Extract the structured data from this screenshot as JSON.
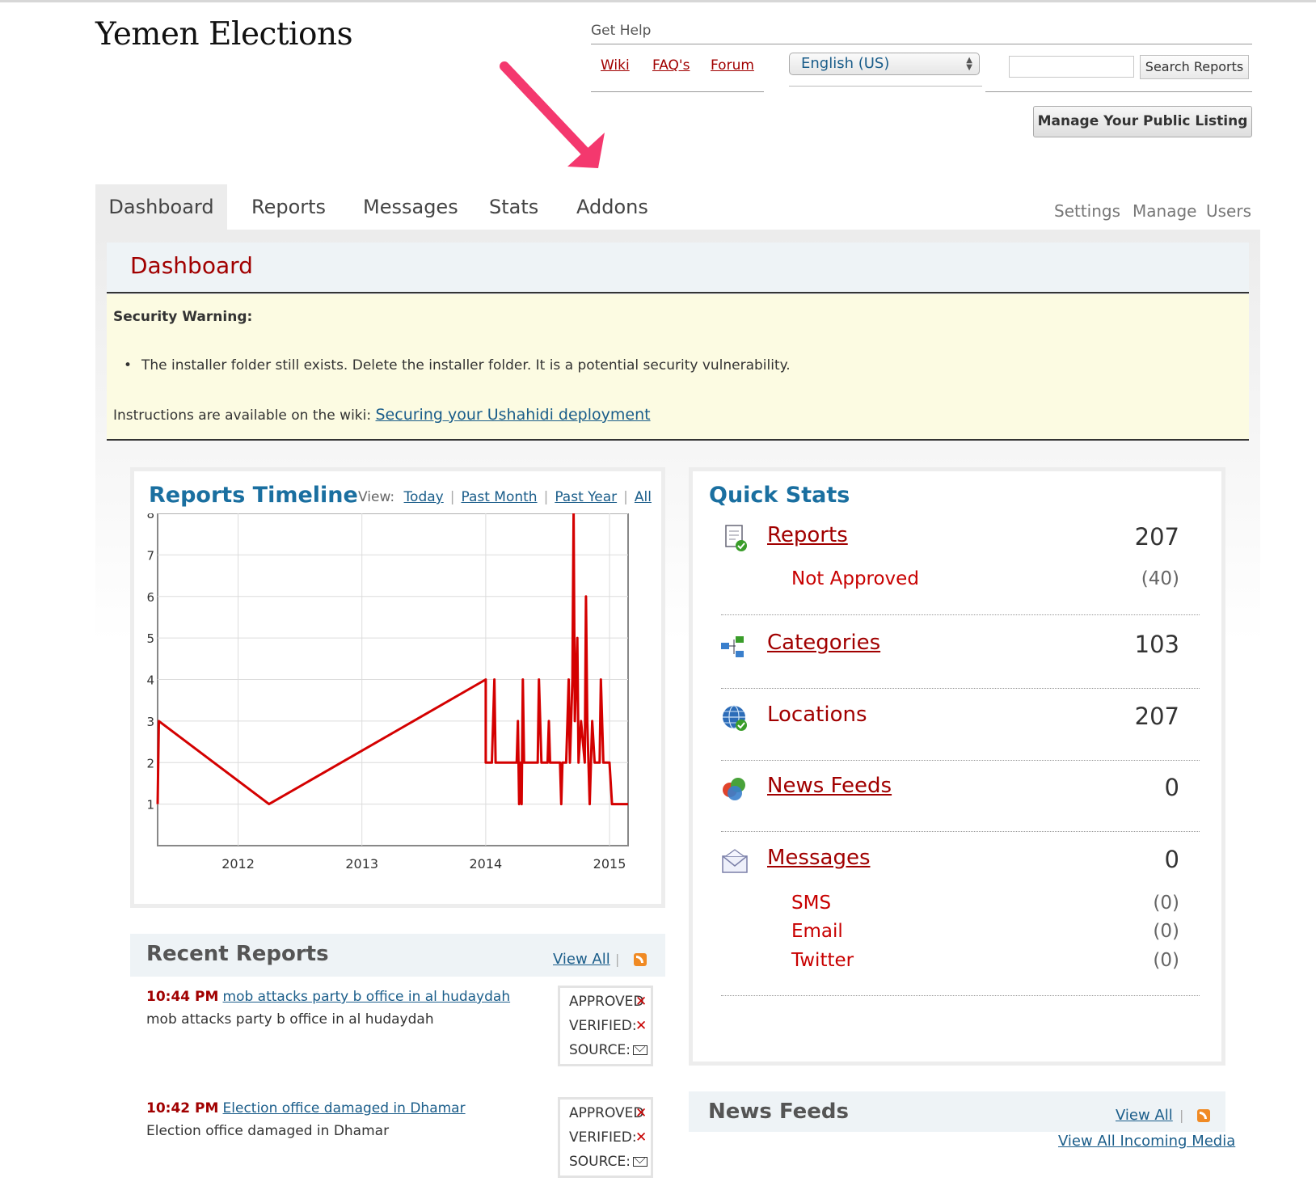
{
  "site": {
    "title": "Yemen Elections"
  },
  "help": {
    "label": "Get Help",
    "links": [
      "Wiki",
      "FAQ's",
      "Forum"
    ]
  },
  "language": {
    "selected": "English (US)"
  },
  "search": {
    "placeholder": "",
    "button": "Search Reports"
  },
  "manage_listing": "Manage Your Public Listing",
  "nav": {
    "tabs": [
      "Dashboard",
      "Reports",
      "Messages",
      "Stats",
      "Addons"
    ],
    "active": "Dashboard",
    "sub": [
      "Settings",
      "Manage",
      "Users"
    ]
  },
  "page": {
    "title": "Dashboard"
  },
  "warning": {
    "title": "Security Warning:",
    "bullet": "The installer folder still exists. Delete the installer folder. It is a potential security vulnerability.",
    "instructions_prefix": "Instructions are available on the wiki: ",
    "instructions_link": "Securing your Ushahidi deployment"
  },
  "timeline": {
    "title": "Reports Timeline",
    "view_label": "View:",
    "view_options": [
      "Today",
      "Past Month",
      "Past Year",
      "All"
    ]
  },
  "chart_data": {
    "type": "line",
    "title": "",
    "xlabel": "",
    "ylabel": "",
    "x_ticks": [
      "2012",
      "2013",
      "2014",
      "2015"
    ],
    "y_ticks": [
      1,
      2,
      3,
      4,
      5,
      6,
      7,
      8
    ],
    "xlim": [
      2011.35,
      2015.15
    ],
    "ylim": [
      0.0,
      8.0
    ],
    "grid": true,
    "series": [
      {
        "color": "#d40000",
        "points": [
          [
            2011.35,
            1
          ],
          [
            2011.36,
            3
          ],
          [
            2012.25,
            1
          ],
          [
            2014.0,
            4
          ],
          [
            2014.0,
            2
          ],
          [
            2014.05,
            2
          ],
          [
            2014.07,
            4
          ],
          [
            2014.08,
            2
          ],
          [
            2014.25,
            2
          ],
          [
            2014.26,
            3
          ],
          [
            2014.27,
            1
          ],
          [
            2014.28,
            2
          ],
          [
            2014.29,
            1
          ],
          [
            2014.3,
            4
          ],
          [
            2014.31,
            2
          ],
          [
            2014.42,
            2
          ],
          [
            2014.43,
            4
          ],
          [
            2014.45,
            2
          ],
          [
            2014.5,
            2
          ],
          [
            2014.51,
            3
          ],
          [
            2014.52,
            2
          ],
          [
            2014.6,
            2
          ],
          [
            2014.61,
            1
          ],
          [
            2014.62,
            2
          ],
          [
            2014.65,
            2
          ],
          [
            2014.66,
            3
          ],
          [
            2014.67,
            4
          ],
          [
            2014.68,
            2
          ],
          [
            2014.7,
            4
          ],
          [
            2014.71,
            8
          ],
          [
            2014.72,
            3
          ],
          [
            2014.74,
            5
          ],
          [
            2014.75,
            2
          ],
          [
            2014.77,
            3
          ],
          [
            2014.8,
            2
          ],
          [
            2014.81,
            6
          ],
          [
            2014.82,
            3
          ],
          [
            2014.84,
            1
          ],
          [
            2014.86,
            3
          ],
          [
            2014.88,
            2
          ],
          [
            2014.92,
            2
          ],
          [
            2014.93,
            4
          ],
          [
            2014.95,
            2
          ],
          [
            2014.98,
            2
          ],
          [
            2015.0,
            2
          ],
          [
            2015.02,
            1
          ],
          [
            2015.06,
            1
          ],
          [
            2015.15,
            1
          ]
        ]
      }
    ]
  },
  "quick_stats": {
    "title": "Quick Stats",
    "items": [
      {
        "label": "Reports",
        "value": "207",
        "sub": [
          {
            "label": "Not Approved",
            "value": "(40)"
          }
        ]
      },
      {
        "label": "Categories",
        "value": "103",
        "sub": []
      },
      {
        "label": "Locations",
        "value": "207",
        "sub": []
      },
      {
        "label": "News Feeds",
        "value": "0",
        "sub": []
      },
      {
        "label": "Messages",
        "value": "0",
        "sub": [
          {
            "label": "SMS",
            "value": "(0)"
          },
          {
            "label": "Email",
            "value": "(0)"
          },
          {
            "label": "Twitter",
            "value": "(0)"
          }
        ]
      }
    ]
  },
  "recent_reports": {
    "title": "Recent Reports",
    "view_all": "View All",
    "status_labels": {
      "approved": "APPROVED",
      "verified": "VERIFIED:",
      "source": "SOURCE:"
    },
    "items": [
      {
        "time": "10:44 PM",
        "title": "mob attacks party b office in al hudaydah",
        "desc": "mob attacks party b office in al hudaydah"
      },
      {
        "time": "10:42 PM",
        "title": "Election office damaged in Dhamar",
        "desc": "Election office damaged in Dhamar"
      }
    ]
  },
  "news_feeds": {
    "title": "News Feeds",
    "view_all": "View All",
    "view_all_media": "View All Incoming Media"
  },
  "colors": {
    "brand_red": "#a10000",
    "link_blue": "#1a5d8a",
    "heading_blue": "#1a6fa0",
    "annotation_arrow": "#f4386e"
  }
}
